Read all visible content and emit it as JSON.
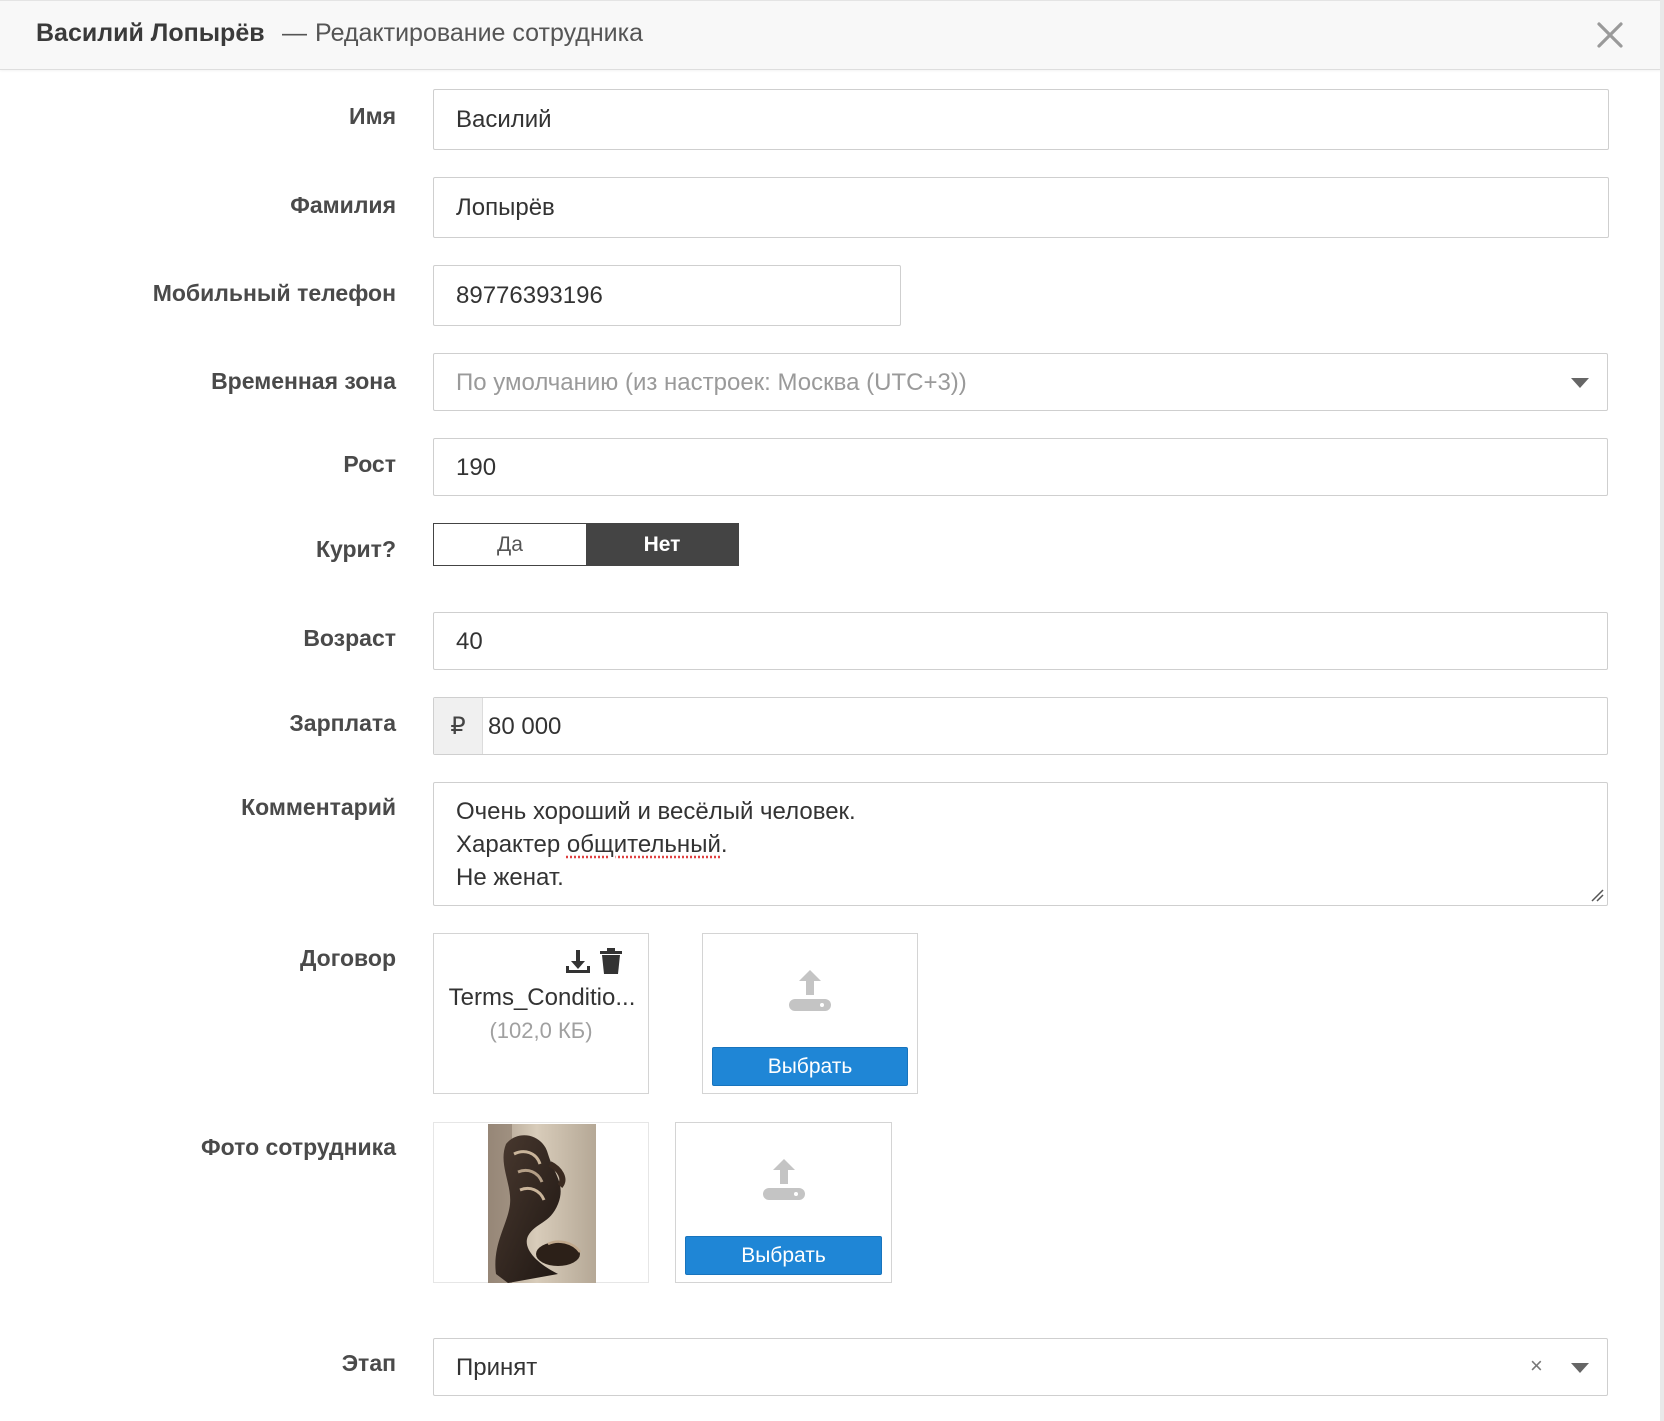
{
  "header": {
    "employee_name": "Василий Лопырёв",
    "separator": "—",
    "subtitle": "Редактирование сотрудника"
  },
  "form": {
    "first_name": {
      "label": "Имя",
      "value": "Василий"
    },
    "last_name": {
      "label": "Фамилия",
      "value": "Лопырёв"
    },
    "mobile_phone": {
      "label": "Мобильный телефон",
      "value": "89776393196"
    },
    "timezone": {
      "label": "Временная зона",
      "placeholder": "По умолчанию (из настроек: Москва (UTC+3))"
    },
    "height": {
      "label": "Рост",
      "value": "190"
    },
    "smokes": {
      "label": "Курит?",
      "yes": "Да",
      "no": "Нет",
      "selected": "Нет"
    },
    "age": {
      "label": "Возраст",
      "value": "40"
    },
    "salary": {
      "label": "Зарплата",
      "currency_symbol": "₽",
      "value": "80 000"
    },
    "comment": {
      "label": "Комментарий",
      "line1": "Очень хороший и весёлый человек.",
      "line2_prefix": "Характер ",
      "line2_misspelled": "общительный",
      "line2_suffix": ".",
      "line3": "Не женат."
    },
    "contract": {
      "label": "Договор",
      "file_name": "Terms_Conditio...",
      "file_size": "(102,0 КБ)",
      "choose_label": "Выбрать"
    },
    "photo": {
      "label": "Фото сотрудника",
      "choose_label": "Выбрать"
    },
    "stage": {
      "label": "Этап",
      "value": "Принят",
      "clear_symbol": "×"
    }
  },
  "colors": {
    "primary_button": "#1f86d6",
    "toggle_active": "#444444",
    "header_bg": "#f8f8f8"
  },
  "icons": {
    "close": "close-icon",
    "dropdown": "chevron-down-icon",
    "download": "download-icon",
    "delete": "trash-icon",
    "upload": "upload-icon"
  }
}
